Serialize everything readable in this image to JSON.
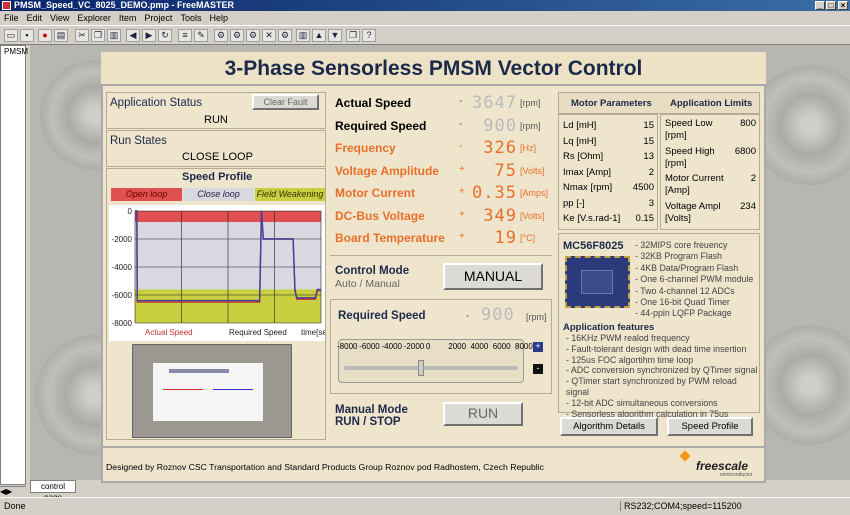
{
  "window": {
    "title": "PMSM_Speed_VC_8025_DEMO.pmp - FreeMASTER",
    "controls": [
      "_",
      "□",
      "×"
    ]
  },
  "menu": [
    "File",
    "Edit",
    "View",
    "Explorer",
    "Item",
    "Project",
    "Tools",
    "Help"
  ],
  "tree": {
    "root": "PMSM"
  },
  "panel": {
    "title": "3-Phase Sensorless PMSM Vector Control",
    "app_status": {
      "label": "Application Status",
      "value": "RUN",
      "fault_button": "Clear Fault"
    },
    "run_states": {
      "label": "Run States",
      "value": "CLOSE LOOP"
    },
    "speed_profile": {
      "label": "Speed Profile",
      "legend": [
        "Open loop",
        "Close loop",
        "Field Weakening"
      ],
      "legend_colors": [
        "#e05050",
        "#d8d8e0",
        "#c8d040"
      ]
    },
    "values": [
      {
        "name": "Actual Speed",
        "sign": "-",
        "value": "3647",
        "unit": "[rpm]",
        "orange": false
      },
      {
        "name": "Required Speed",
        "sign": "-",
        "value": "900",
        "unit": "[rpm]",
        "orange": false
      },
      {
        "name": "Frequency",
        "sign": "-",
        "value": "326",
        "unit": "[Hz]",
        "orange": true
      },
      {
        "name": "Voltage Amplitude",
        "sign": "+",
        "value": "75",
        "unit": "[Volts]",
        "orange": true
      },
      {
        "name": "Motor Current",
        "sign": "+",
        "value": "0.35",
        "unit": "[Amps]",
        "orange": true
      },
      {
        "name": "DC-Bus Voltage",
        "sign": "+",
        "value": "349",
        "unit": "[Volts]",
        "orange": true
      },
      {
        "name": "Board Temperature",
        "sign": "+",
        "value": "19",
        "unit": "[°C]",
        "orange": true
      }
    ],
    "control_mode": {
      "label": "Control Mode",
      "sub": "Auto / Manual",
      "button": "MANUAL"
    },
    "required_speed_slider": {
      "label": "Required Speed",
      "sign": "-",
      "value": "900",
      "unit": "[rpm]",
      "scale": [
        "-8000",
        "-6000",
        "-4000",
        "-2000",
        "0",
        "2000",
        "4000",
        "6000",
        "8000"
      ],
      "level": 0.444,
      "plus": "+",
      "minus": "-"
    },
    "manual_mode": {
      "label1": "Manual Mode",
      "label2": "RUN / STOP",
      "button": "RUN"
    },
    "motor_params": {
      "header": "Motor Parameters",
      "rows": [
        [
          "Ld [mH]",
          "15"
        ],
        [
          "Lq [mH]",
          "15"
        ],
        [
          "Rs [Ohm]",
          "13"
        ],
        [
          "Imax [Amp]",
          "2"
        ],
        [
          "Nmax [rpm]",
          "4500"
        ],
        [
          "pp [-]",
          "3"
        ],
        [
          "Ke [V.s.rad-1]",
          "0.15"
        ]
      ]
    },
    "app_limits": {
      "header": "Application Limits",
      "rows": [
        [
          "Speed Low [rpm]",
          "800"
        ],
        [
          "Speed High [rpm]",
          "6800"
        ],
        [
          "Motor Current [Amp]",
          "2"
        ],
        [
          "Voltage Ampl [Volts]",
          "234"
        ]
      ]
    },
    "mcu": {
      "name": "MC56F8025",
      "features": [
        "- 32MIPS core freuency",
        "- 32KB Program Flash",
        "- 4KB Data/Program Flash",
        "- One 6-channel PWM module",
        "- Two 4-channel 12 ADCs",
        "- One 16-bit Quad Timer",
        "- 44-ppin LQFP Package"
      ]
    },
    "app_features": {
      "title": "Application features",
      "items": [
        "- 16KHz PWM realod frequency",
        "- Fault-tolerant design with dead time insertion",
        "- 125us FOC algortihm time loop",
        "- ADC conversion synchronized by QTimer signal",
        "- QTimer start synchronized by PWM reload signal",
        "- 12-bit ADC simultaneous conversions",
        "- Sensorless algorithm calculation in 75us"
      ]
    },
    "buttons": {
      "algorithm": "Algorithm Details",
      "speed_profile": "Speed Profile"
    },
    "footer": "Designed by Roznov CSC Transportation and Standard Products Group Roznov pod Radhostem, Czech Republic",
    "logo": "freescale",
    "logo_sub": "semiconductor"
  },
  "chart_data": {
    "type": "line",
    "ylim": [
      -8000,
      0
    ],
    "y_ticks": [
      "0",
      "-2000",
      "-4000",
      "-6000",
      "-8000"
    ],
    "x_labels": [
      "Actual Speed",
      "Required Speed",
      "time[sec]"
    ],
    "series": [
      {
        "name": "Actual Speed",
        "color": "#c03030",
        "x": [
          0,
          0.01,
          0.012,
          0.67,
          0.68,
          0.69,
          0.85,
          0.86,
          0.87,
          0.97,
          0.98,
          1
        ],
        "y": [
          0,
          0,
          -6500,
          -6500,
          0,
          -2000,
          -2000,
          -5600,
          -6300,
          -6300,
          -5700,
          -5700
        ]
      },
      {
        "name": "Required Speed",
        "color": "#4040a0",
        "x": [
          0,
          0.01,
          0.012,
          0.67,
          0.68,
          0.69,
          0.85,
          0.86,
          0.87,
          0.97,
          0.98,
          1
        ],
        "y": [
          0,
          0,
          -6400,
          -6400,
          0,
          -2000,
          -2000,
          -5700,
          -6200,
          -6200,
          -5600,
          -5600
        ]
      }
    ],
    "bands": [
      {
        "from": 0,
        "to": -800,
        "color": "#e05050"
      },
      {
        "from": -800,
        "to": -5600,
        "color": "#d8d8e0"
      },
      {
        "from": -5600,
        "to": -8000,
        "color": "#c8d040"
      }
    ]
  },
  "tabs": [
    "control page"
  ],
  "status": {
    "left": "Done",
    "right": "RS232;COM4;speed=115200"
  }
}
